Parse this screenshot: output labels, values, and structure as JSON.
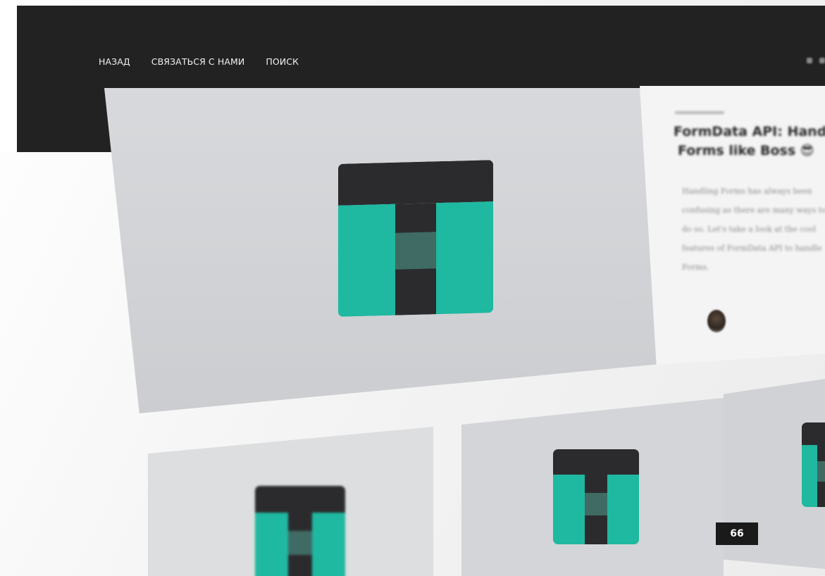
{
  "nav": {
    "back": "НАЗАД",
    "contact": "СВЯЗАТЬСЯ С НАМИ",
    "search": "ПОИСК"
  },
  "featured": {
    "title_line1": "FormData API: Handling",
    "title_line2": "Forms like Boss 😎",
    "excerpt": "Handling Forms has always been confusing as there are many ways to do so. Let's take a look at the cool features of FormData API to handle Forms."
  },
  "badge": "66",
  "colors": {
    "header": "#222222",
    "teal": "#1fb8a0",
    "dark": "#2b2b2d",
    "card": "#d7d9dc"
  }
}
